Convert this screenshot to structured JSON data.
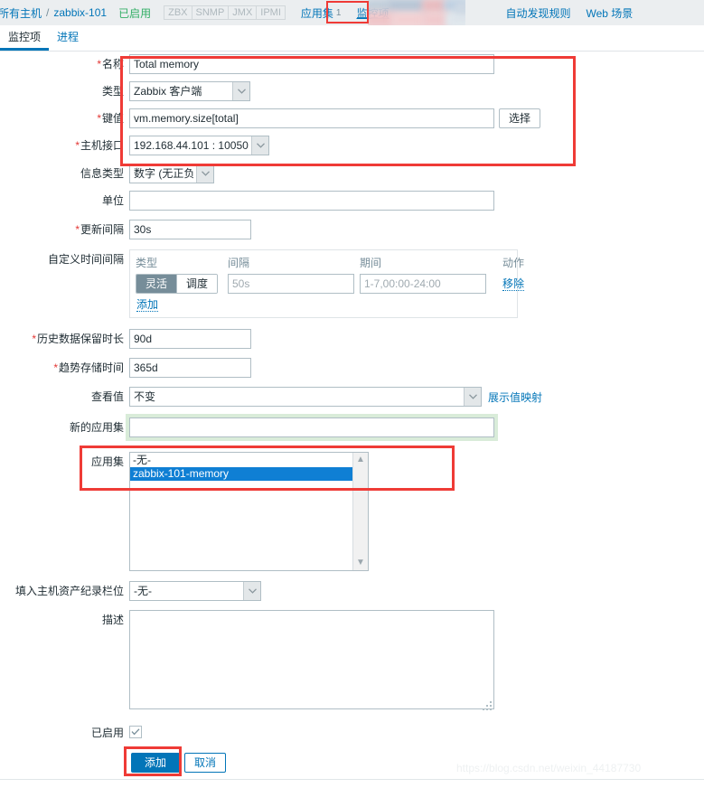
{
  "breadcrumb": {
    "all_hosts": "所有主机",
    "separator": "/",
    "host": "zabbix-101",
    "status": "已启用",
    "protocols": [
      "ZBX",
      "SNMP",
      "JMX",
      "IPMI"
    ],
    "items": [
      {
        "label": "应用集",
        "count": "1"
      },
      {
        "label": "监控项",
        "count": ""
      },
      {
        "label": "自动发现规则",
        "count": ""
      },
      {
        "label": "Web 场景",
        "count": ""
      }
    ],
    "current": "监控项"
  },
  "tabs": [
    {
      "label": "监控项",
      "active": true
    },
    {
      "label": "进程",
      "active": false
    }
  ],
  "form": {
    "name": {
      "label": "名称",
      "required": true,
      "value": "Total memory"
    },
    "type": {
      "label": "类型",
      "required": false,
      "value": "Zabbix 客户端"
    },
    "key": {
      "label": "键值",
      "required": true,
      "value": "vm.memory.size[total]",
      "select_button": "选择"
    },
    "host_interface": {
      "label": "主机接口",
      "required": true,
      "value": "192.168.44.101 : 10050"
    },
    "info_type": {
      "label": "信息类型",
      "required": false,
      "value": "数字 (无正负)"
    },
    "units": {
      "label": "单位",
      "required": false,
      "value": ""
    },
    "update_interval": {
      "label": "更新间隔",
      "required": true,
      "value": "30s"
    },
    "custom_intervals": {
      "label": "自定义时间间隔",
      "columns": [
        "类型",
        "间隔",
        "期间",
        "动作"
      ],
      "rows": [
        {
          "type_options": [
            "灵活",
            "调度"
          ],
          "type_selected": "灵活",
          "interval_value": "",
          "interval_placeholder": "50s",
          "period_value": "",
          "period_placeholder": "1-7,00:00-24:00",
          "action": "移除"
        }
      ],
      "add_link": "添加"
    },
    "history": {
      "label": "历史数据保留时长",
      "required": true,
      "value": "90d"
    },
    "trends": {
      "label": "趋势存储时间",
      "required": true,
      "value": "365d"
    },
    "value_map": {
      "label": "查看值",
      "required": false,
      "value": "不变",
      "link": "展示值映射"
    },
    "new_application": {
      "label": "新的应用集",
      "required": false,
      "value": ""
    },
    "applications": {
      "label": "应用集",
      "options": [
        {
          "label": "-无-",
          "selected": false
        },
        {
          "label": "zabbix-101-memory",
          "selected": true
        }
      ]
    },
    "inventory_field": {
      "label": "填入主机资产纪录栏位",
      "required": false,
      "value": "-无-"
    },
    "description": {
      "label": "描述",
      "required": false,
      "value": ""
    },
    "enabled": {
      "label": "已启用",
      "checked": true
    }
  },
  "actions": {
    "submit": "添加",
    "cancel": "取消"
  },
  "watermark": "https://blog.csdn.net/weixin_44187730",
  "colors": {
    "accent": "#0275b8",
    "annotation": "#ef3b36",
    "required": "#e33734",
    "enabled_status": "#34af67",
    "selected_option": "#0f7fd4"
  }
}
